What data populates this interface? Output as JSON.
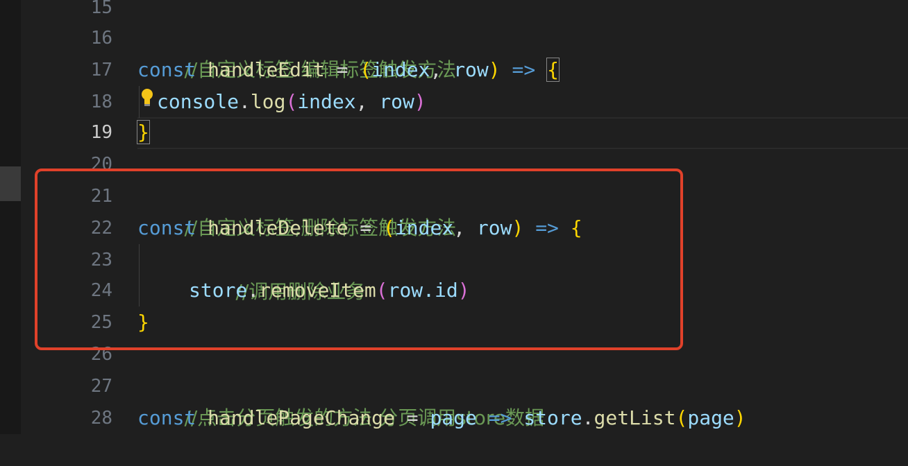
{
  "editor": {
    "line_numbers": [
      "15",
      "16",
      "17",
      "18",
      "19",
      "20",
      "21",
      "22",
      "23",
      "24",
      "25",
      "26",
      "27",
      "28"
    ],
    "active_line": "19",
    "lines": {
      "l16": {
        "comment": "//自定义标签 编辑标签触发方法"
      },
      "l17": {
        "kw": "const",
        "name": "handleEdit",
        "eq": "=",
        "open": "(",
        "p1": "index",
        "comma": ",",
        "p2": "row",
        "close": ")",
        "arrow": "=>",
        "brace": "{"
      },
      "l18": {
        "obj": "console",
        "dot": ".",
        "method": "log",
        "open": "(",
        "p1": "index",
        "comma": ",",
        "p2": "row",
        "close": ")"
      },
      "l19": {
        "brace": "}"
      },
      "l21": {
        "comment": "//自定义标签,删除标签触发方法"
      },
      "l22": {
        "kw": "const",
        "name": "handleDelete",
        "eq": "=",
        "open": "(",
        "p1": "index",
        "comma": ",",
        "p2": "row",
        "close": ")",
        "arrow": "=>",
        "brace": "{"
      },
      "l23": {
        "comment": "//调用删除业务"
      },
      "l24": {
        "obj": "store",
        "dot": ".",
        "method": "removeItem",
        "open": "(",
        "arg": "row.id",
        "close": ")"
      },
      "l25": {
        "brace": "}"
      },
      "l27": {
        "comment": "//点击分页触发的方法 分页调用store数据"
      },
      "l28": {
        "kw": "const",
        "name": "handlePageChange",
        "eq": "=",
        "param": "page",
        "arrow": "=>",
        "obj": "store",
        "dot": ".",
        "method": "getList",
        "open": "(",
        "arg": "page",
        "close": ")"
      }
    },
    "lightbulb_icon": "lightbulb-icon",
    "highlight_color": "#e0412a"
  }
}
